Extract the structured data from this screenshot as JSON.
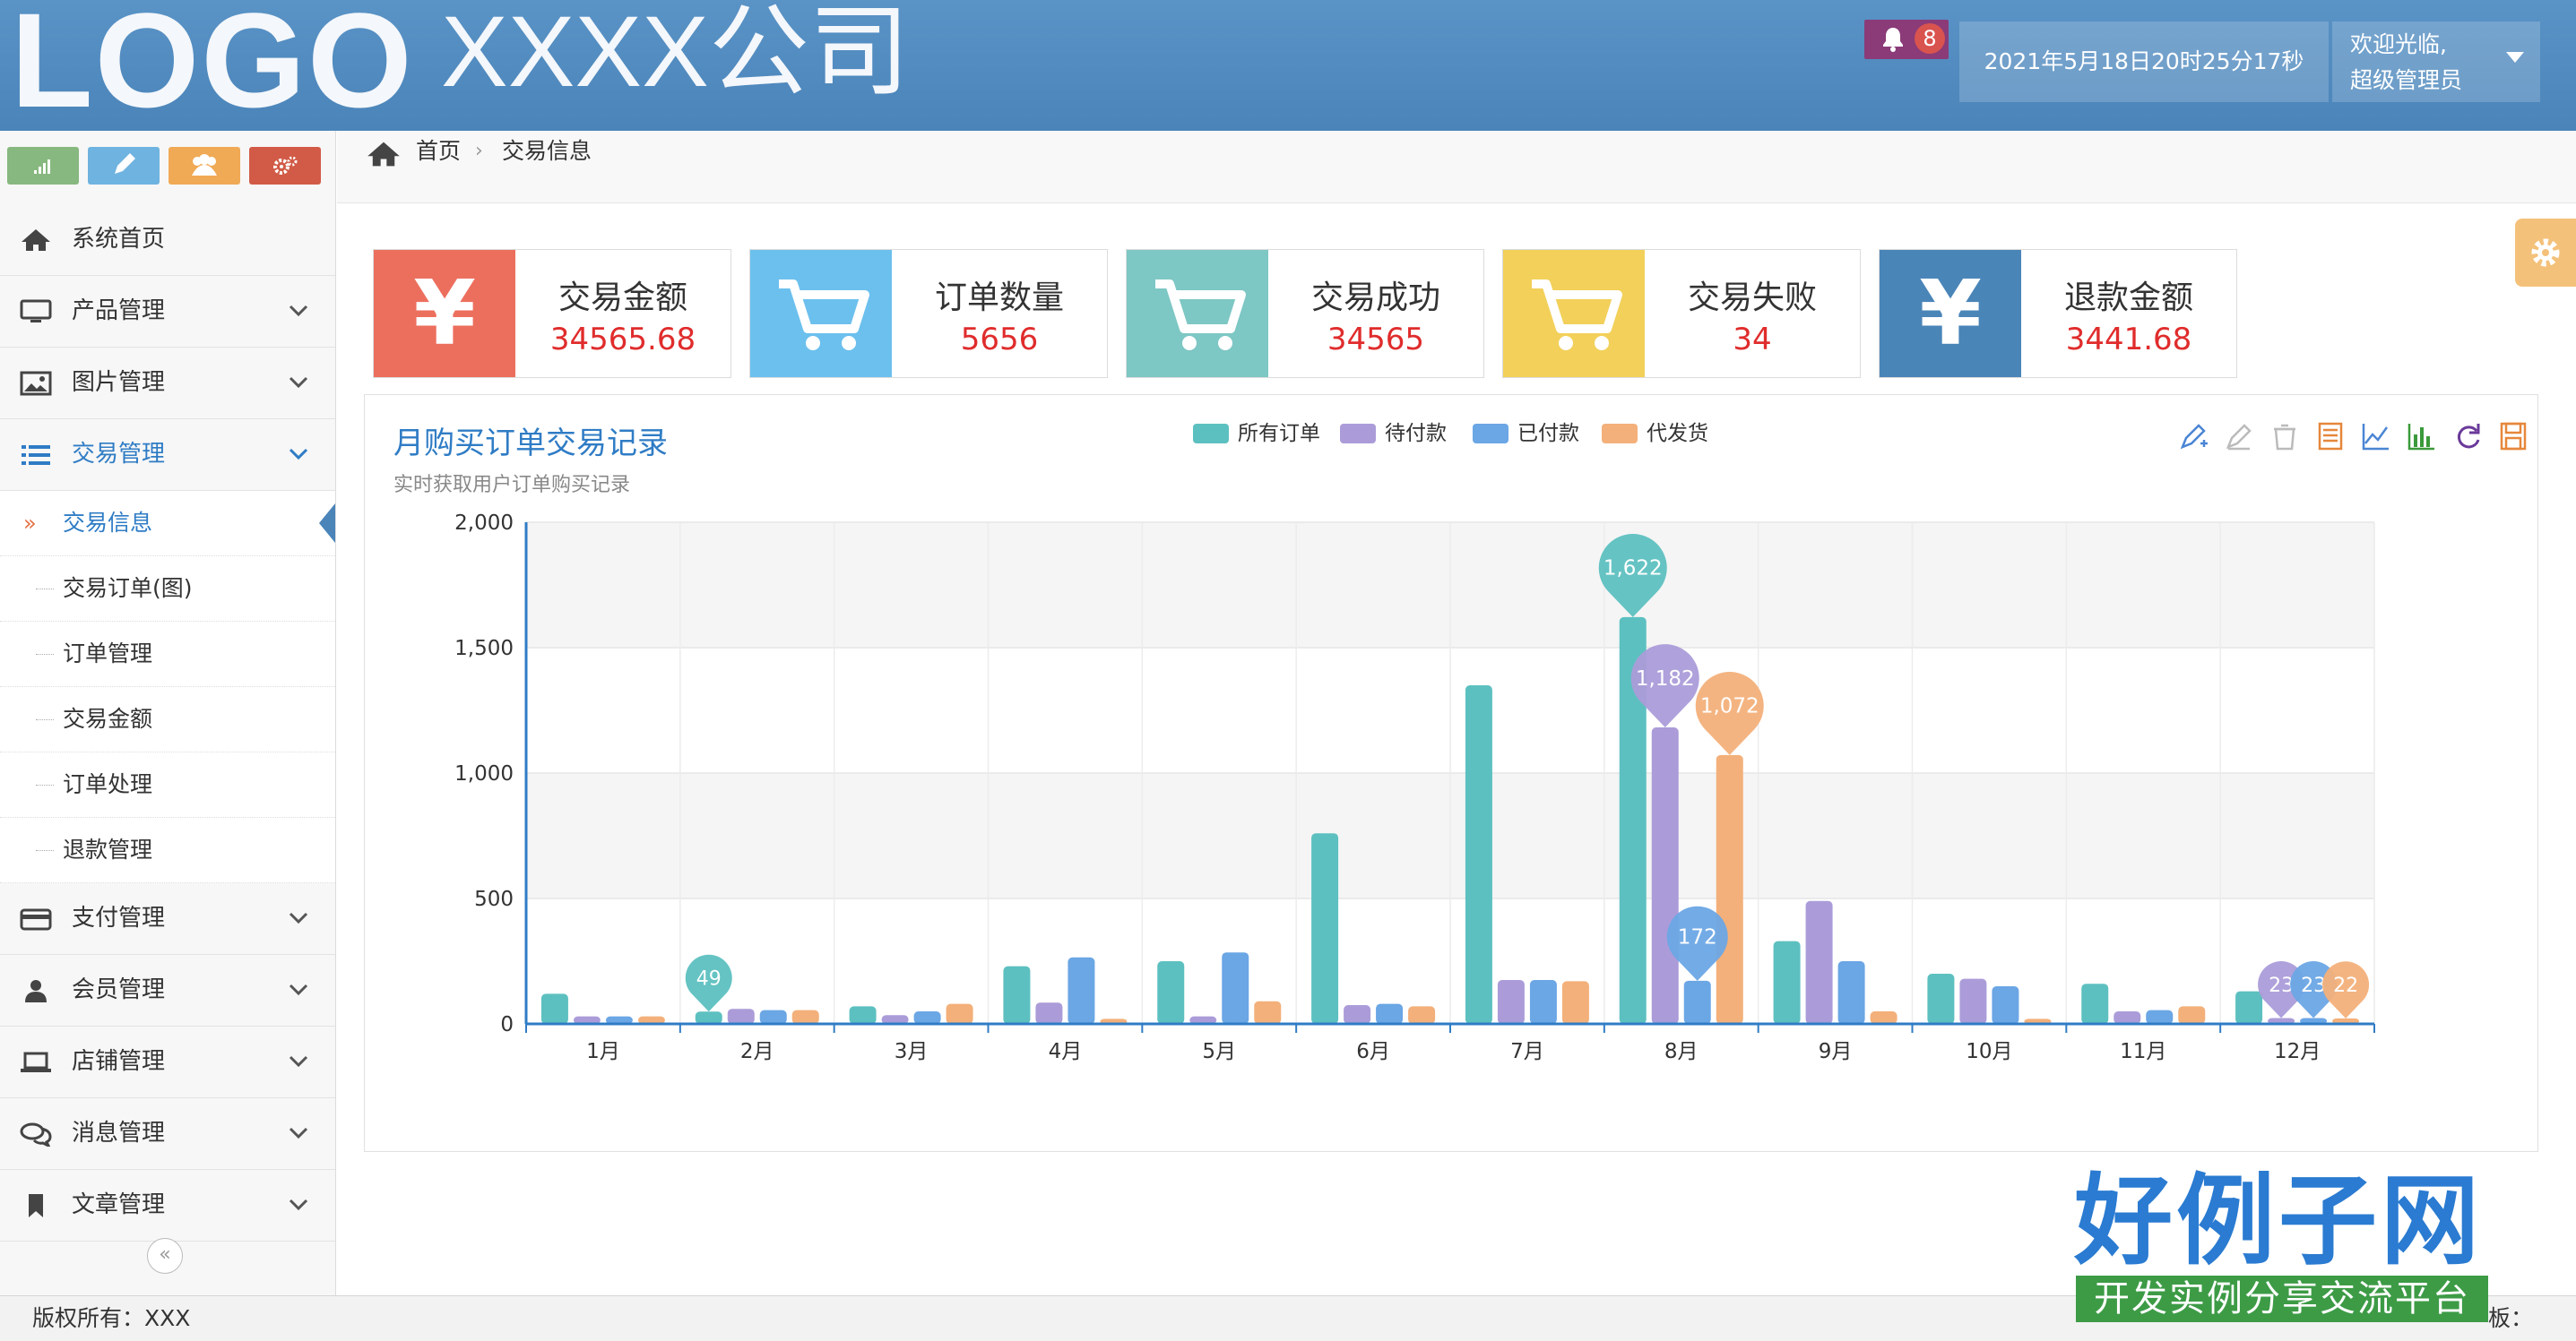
{
  "header": {
    "logo": "LOGO",
    "company": "XXXX公司",
    "notifications": "8",
    "datetime": "2021年5月18日20时25分17秒",
    "welcome_line1": "欢迎光临,",
    "welcome_line2": "超级管理员"
  },
  "sidebar": {
    "quick_buttons": [
      {
        "icon": "signal-icon",
        "color": "#87b87f"
      },
      {
        "icon": "pencil-icon",
        "color": "#6fb3e0"
      },
      {
        "icon": "users-icon",
        "color": "#f0a955"
      },
      {
        "icon": "cogs-icon",
        "color": "#d15b47"
      }
    ],
    "menu": [
      {
        "label": "系统首页",
        "icon": "home-icon"
      },
      {
        "label": "产品管理",
        "icon": "desktop-icon"
      },
      {
        "label": "图片管理",
        "icon": "picture-icon"
      },
      {
        "label": "交易管理",
        "icon": "list-icon"
      },
      {
        "label": "支付管理",
        "icon": "credit-card-icon"
      },
      {
        "label": "会员管理",
        "icon": "user-icon"
      },
      {
        "label": "店铺管理",
        "icon": "laptop-icon"
      },
      {
        "label": "消息管理",
        "icon": "comments-icon"
      },
      {
        "label": "文章管理",
        "icon": "bookmark-icon"
      }
    ],
    "submenu": [
      "交易信息",
      "交易订单(图)",
      "订单管理",
      "交易金额",
      "订单处理",
      "退款管理"
    ],
    "submenu_arrow": "»",
    "collapse_icon": "«"
  },
  "breadcrumb": {
    "home": "首页",
    "separator": "›",
    "current": "交易信息"
  },
  "cards": [
    {
      "title": "交易金额",
      "value": "34565.68",
      "icon": "yen-icon",
      "symbol": "¥",
      "color": "#ec6f5e"
    },
    {
      "title": "订单数量",
      "value": "5656",
      "icon": "cart-icon",
      "symbol": "",
      "color": "#6cc0ee"
    },
    {
      "title": "交易成功",
      "value": "34565",
      "icon": "cart-icon",
      "symbol": "",
      "color": "#7dc7c4"
    },
    {
      "title": "交易失败",
      "value": "34",
      "icon": "cart-icon",
      "symbol": "",
      "color": "#f2d05a"
    },
    {
      "title": "退款金额",
      "value": "3441.68",
      "icon": "yen-icon",
      "symbol": "¥",
      "color": "#4a85b8"
    }
  ],
  "chart_panel": {
    "title": "月购买订单交易记录",
    "subtitle": "实时获取用户订单购买记录"
  },
  "chart_data": {
    "type": "bar",
    "title": "月购买订单交易记录",
    "subtitle": "实时获取用户订单购买记录",
    "categories": [
      "1月",
      "2月",
      "3月",
      "4月",
      "5月",
      "6月",
      "7月",
      "8月",
      "9月",
      "10月",
      "11月",
      "12月"
    ],
    "ylim": [
      0,
      2000
    ],
    "yticks": [
      0,
      500,
      1000,
      1500,
      2000
    ],
    "ytick_labels": [
      "0",
      "500",
      "1,000",
      "1,500",
      "2,000"
    ],
    "grid": true,
    "legend_position": "top-center",
    "series": [
      {
        "name": "所有订单",
        "color": "#5dc0c0",
        "values": [
          120,
          49,
          70,
          230,
          250,
          760,
          1350,
          1622,
          330,
          200,
          160,
          130
        ]
      },
      {
        "name": "待付款",
        "color": "#ab9cd9",
        "values": [
          30,
          60,
          35,
          85,
          30,
          75,
          175,
          1182,
          490,
          180,
          50,
          23
        ]
      },
      {
        "name": "已付款",
        "color": "#6ba6e5",
        "values": [
          30,
          55,
          50,
          265,
          285,
          80,
          175,
          172,
          250,
          150,
          55,
          23
        ]
      },
      {
        "name": "代发货",
        "color": "#f3b07a",
        "values": [
          30,
          55,
          80,
          20,
          90,
          70,
          170,
          1072,
          50,
          20,
          70,
          22
        ]
      }
    ],
    "markers": [
      {
        "series": 0,
        "index": 1,
        "label": "49"
      },
      {
        "series": 0,
        "index": 7,
        "label": "1,622"
      },
      {
        "series": 1,
        "index": 7,
        "label": "1,182"
      },
      {
        "series": 3,
        "index": 7,
        "label": "1,072"
      },
      {
        "series": 2,
        "index": 7,
        "label": "172"
      },
      {
        "series": 1,
        "index": 11,
        "label": "23"
      },
      {
        "series": 2,
        "index": 11,
        "label": "23"
      },
      {
        "series": 3,
        "index": 11,
        "label": "22"
      }
    ]
  },
  "chart_tools": [
    {
      "icon": "mark-icon",
      "color": "#4a85d4"
    },
    {
      "icon": "mark-undo-icon",
      "color": "#bbbbbb"
    },
    {
      "icon": "mark-clear-icon",
      "color": "#bbbbbb"
    },
    {
      "icon": "data-view-icon",
      "color": "#e6873b"
    },
    {
      "icon": "line-chart-icon",
      "color": "#4a85d4"
    },
    {
      "icon": "bar-chart-icon",
      "color": "#3b9a3b"
    },
    {
      "icon": "refresh-icon",
      "color": "#6a3a9a"
    },
    {
      "icon": "save-image-icon",
      "color": "#e6873b"
    }
  ],
  "footer": {
    "copyright": "版权所有：XXX",
    "right": "板："
  },
  "watermark": {
    "title": "好例子网",
    "subtitle": "开发实例分享交流平台"
  }
}
